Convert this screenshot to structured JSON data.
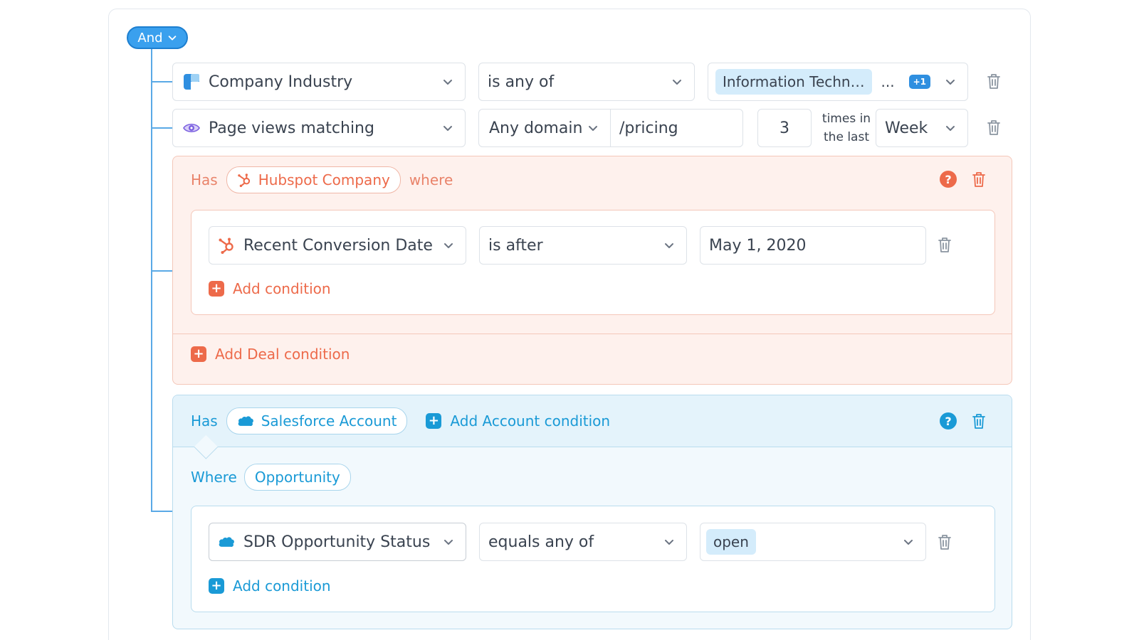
{
  "logic": {
    "operator": "And"
  },
  "rows": [
    {
      "field": "Company Industry",
      "operator": "is any of",
      "value_chip": "Information Techn…",
      "ellipsis": "...",
      "extra_badge": "+1"
    },
    {
      "field": "Page views matching",
      "domain": "Any domain",
      "path": "/pricing",
      "count": "3",
      "times_label_1": "times in",
      "times_label_2": "the last",
      "period": "Week"
    }
  ],
  "hubspot_group": {
    "has": "Has",
    "object": "Hubspot Company",
    "where": "where",
    "condition": {
      "field": "Recent Conversion Date",
      "operator": "is after",
      "value": "May 1, 2020"
    },
    "add_condition": "Add condition",
    "add_deal_condition": "Add Deal condition",
    "help": "?"
  },
  "salesforce_group": {
    "has": "Has",
    "object": "Salesforce Account",
    "add_account_condition": "Add Account condition",
    "where": "Where",
    "related": "Opportunity",
    "condition": {
      "field": "SDR Opportunity Status",
      "operator": "equals any of",
      "value_chip": "open"
    },
    "add_condition": "Add condition",
    "help": "?"
  },
  "colors": {
    "blue": "#1a9ad6",
    "hubspot_orange": "#ed6a4a",
    "and_pill": "#3aa0ee"
  }
}
